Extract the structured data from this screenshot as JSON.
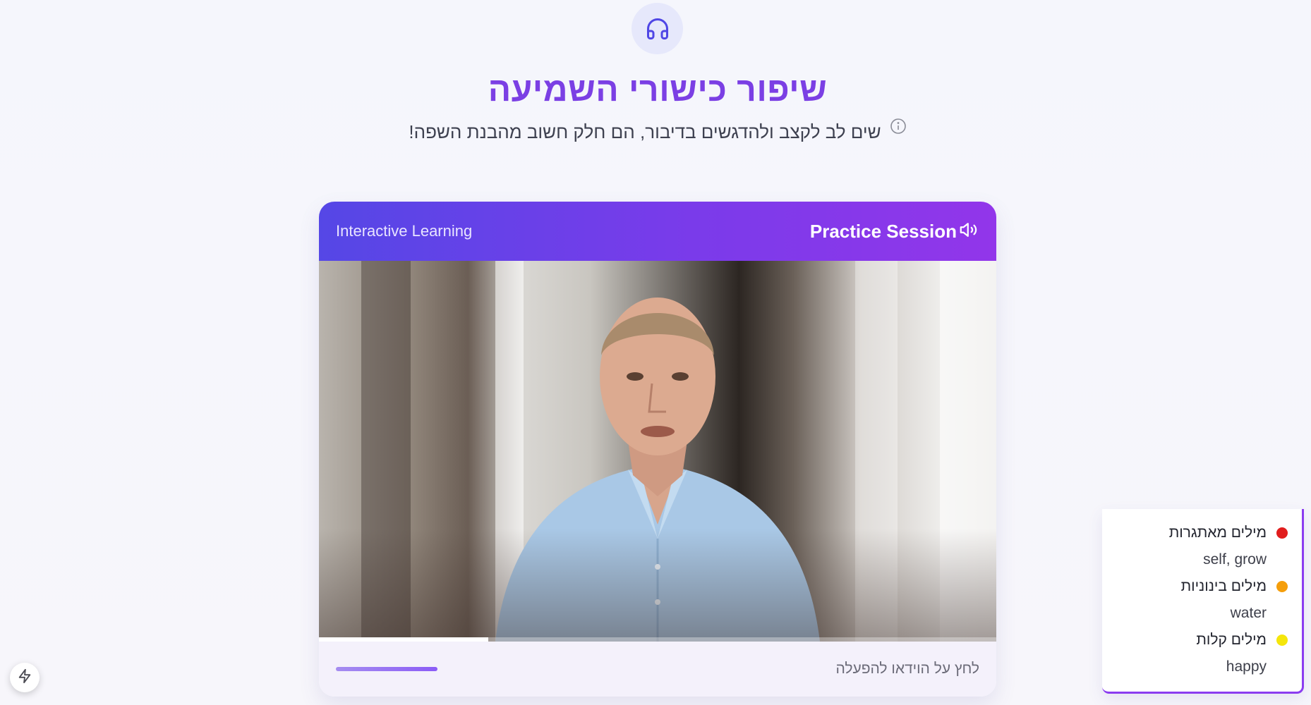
{
  "header": {
    "icon": "headphones-icon",
    "title": "שיפור כישורי השמיעה",
    "subtitle": "שים לב לקצב ולהדגשים בדיבור, הם חלק חשוב מהבנת השפה!",
    "info_icon": "info-icon"
  },
  "card": {
    "title": "Practice Session",
    "title_icon": "speaker-icon",
    "subtitle": "Interactive Learning",
    "video": {
      "progress": 0.25
    },
    "footer": {
      "hint": "לחץ על הוידאו להפעלה"
    }
  },
  "legend": {
    "items": [
      {
        "title": "מילים מאתגרות",
        "words": "self, grow",
        "color": "#e11d1d"
      },
      {
        "title": "מילים בינוניות",
        "words": "water",
        "color": "#f59e0b"
      },
      {
        "title": "מילים קלות",
        "words": "happy",
        "color": "#f5e60b"
      }
    ]
  },
  "floating_button": {
    "icon": "lightning-icon"
  }
}
